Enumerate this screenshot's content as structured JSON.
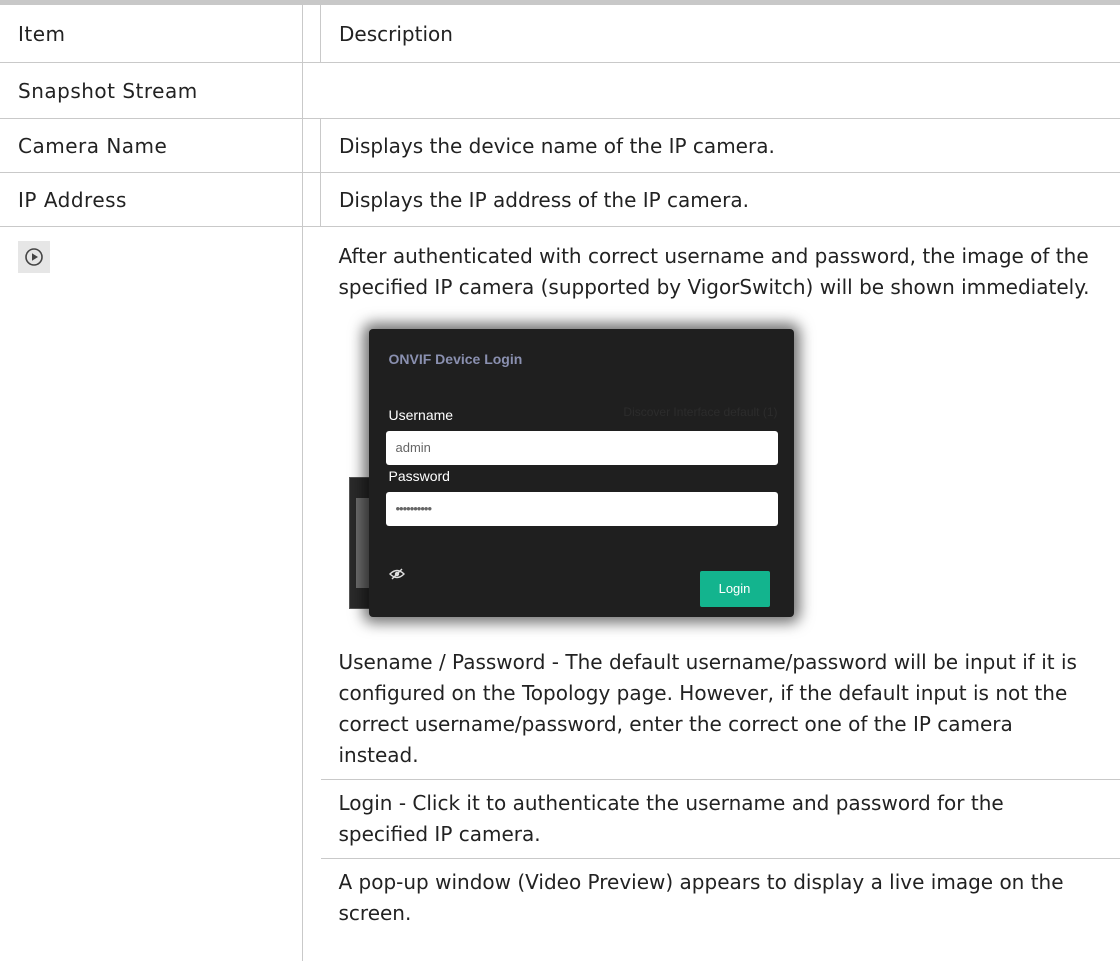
{
  "table": {
    "header": {
      "item": "Item",
      "description": "Description"
    },
    "section": "Snapshot Stream",
    "rows": [
      {
        "item": "Camera Name",
        "description": "Displays the device name of the IP camera."
      },
      {
        "item": "IP Address",
        "description": "Displays the IP address of the IP camera."
      }
    ],
    "play_row": {
      "icon": "play-circle-icon",
      "intro": "After authenticated with correct username and password, the image of the specified IP camera (supported by VigorSwitch) will be shown immediately.",
      "dialog": {
        "title": "ONVIF Device Login",
        "ghost_text": "Discover Interface    default (1)",
        "username_label": "Username",
        "username_value": "admin",
        "password_label": "Password",
        "password_value": "••••••••••",
        "eye_icon": "eye-slash-icon",
        "login_button": "Login",
        "accent_color": "#13b48e"
      },
      "para1": "Usename / Password - The default username/password will be input if it is configured on the Topology page. However, if the default input is not the correct username/password, enter the correct one of the IP camera instead.",
      "para2": "Login - Click it to authenticate the username and password for the specified IP camera.",
      "para3": "A pop-up window (Video Preview) appears to display a live image on the screen."
    }
  }
}
